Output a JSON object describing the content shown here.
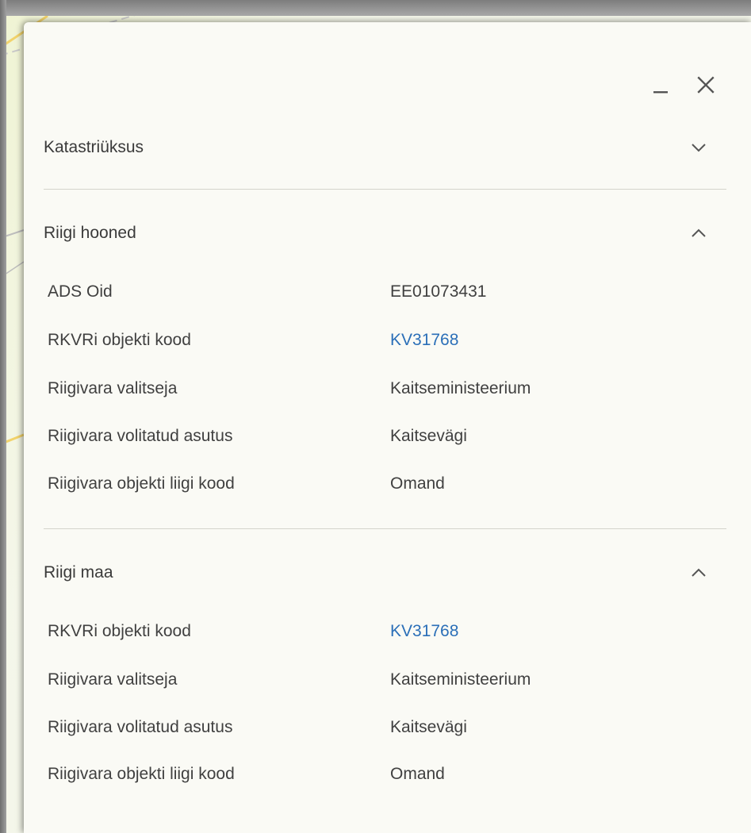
{
  "window": {
    "minimize_icon": "minimize-icon",
    "close_icon": "close-icon"
  },
  "sections": [
    {
      "title": "Katastriüksus",
      "expanded": false,
      "icon": "chevron-down-icon",
      "rows": []
    },
    {
      "title": "Riigi hooned",
      "expanded": true,
      "icon": "chevron-up-icon",
      "rows": [
        {
          "label": "ADS Oid",
          "value": "EE01073431",
          "link": false
        },
        {
          "label": "RKVRi objekti kood",
          "value": "KV31768",
          "link": true
        },
        {
          "label": "Riigivara valitseja",
          "value": "Kaitseministeerium",
          "link": false
        },
        {
          "label": "Riigivara volitatud asutus",
          "value": "Kaitsevägi",
          "link": false
        },
        {
          "label": "Riigivara objekti liigi kood",
          "value": "Omand",
          "link": false
        }
      ]
    },
    {
      "title": "Riigi maa",
      "expanded": true,
      "icon": "chevron-up-icon",
      "rows": [
        {
          "label": "RKVRi objekti kood",
          "value": "KV31768",
          "link": true
        },
        {
          "label": "Riigivara valitseja",
          "value": "Kaitseministeerium",
          "link": false
        },
        {
          "label": "Riigivara volitatud asutus",
          "value": "Kaitsevägi",
          "link": false
        },
        {
          "label": "Riigivara objekti liigi kood",
          "value": "Omand",
          "link": false
        }
      ]
    }
  ],
  "colors": {
    "link": "#2b6fb8",
    "panel_background": "#fafaf5",
    "text": "#404040",
    "divider": "#d4d4cc"
  }
}
